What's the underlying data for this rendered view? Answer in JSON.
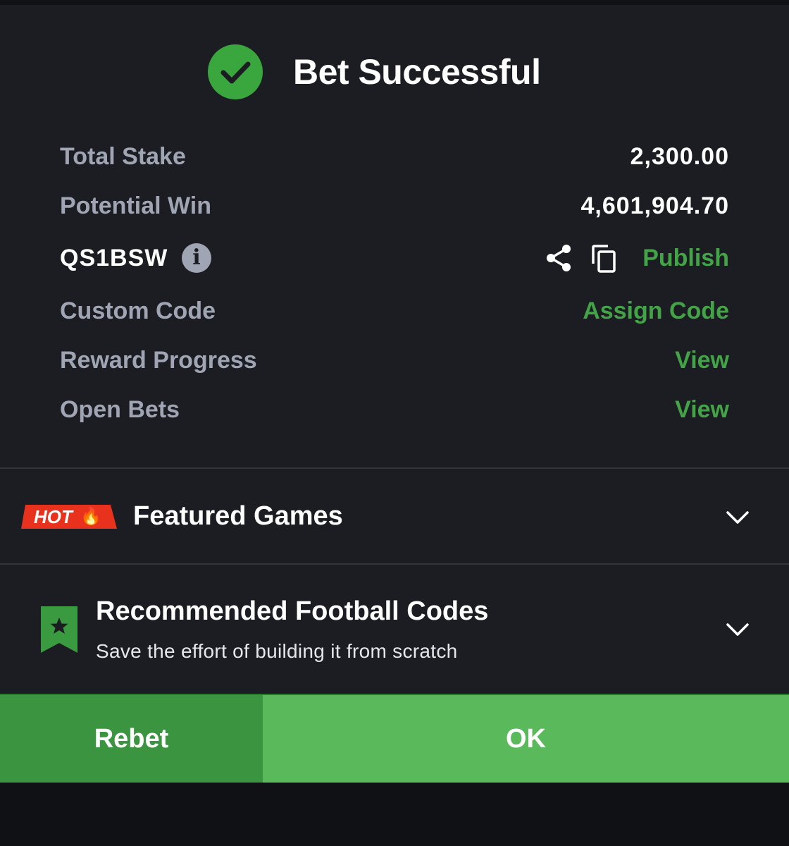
{
  "header": {
    "title": "Bet Successful",
    "icon": "check-circle-icon",
    "icon_color": "#3aa63e"
  },
  "summary": {
    "total_stake_label": "Total Stake",
    "total_stake_value": "2,300.00",
    "potential_win_label": "Potential Win",
    "potential_win_value": "4,601,904.70",
    "booking_code": "QS1BSW",
    "publish_label": "Publish",
    "custom_code_label": "Custom Code",
    "assign_code_label": "Assign Code",
    "reward_progress_label": "Reward Progress",
    "reward_progress_link": "View",
    "open_bets_label": "Open Bets",
    "open_bets_link": "View"
  },
  "featured": {
    "badge_text": "HOT",
    "title": "Featured Games"
  },
  "recommended": {
    "title": "Recommended Football Codes",
    "subtitle": "Save the effort of building it from scratch"
  },
  "actions": {
    "rebet_label": "Rebet",
    "ok_label": "OK"
  },
  "colors": {
    "background": "#1c1d22",
    "accent_green": "#43a347",
    "ok_green": "#59b95b",
    "rebet_green": "#3b943f",
    "hot_red": "#e8321e",
    "label_grey": "#a0a5b4"
  }
}
